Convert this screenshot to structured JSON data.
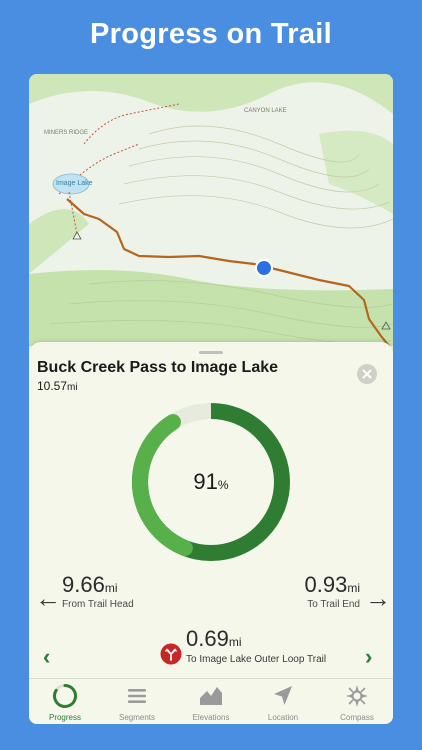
{
  "headline": "Progress on Trail",
  "map": {
    "labels": [
      "Image Lake",
      "CANYON LAKE",
      "MINERS RIDGE"
    ]
  },
  "trail": {
    "name": "Buck Creek Pass to Image Lake",
    "length_value": "10.57",
    "length_unit": "mi",
    "progress_fraction": 0.91,
    "progress_value": "91",
    "progress_unit": "%"
  },
  "from_head": {
    "value": "9.66",
    "unit": "mi",
    "caption": "From Trail Head"
  },
  "to_end": {
    "value": "0.93",
    "unit": "mi",
    "caption": "To Trail End"
  },
  "waypoint": {
    "value": "0.69",
    "unit": "mi",
    "caption": "To Image Lake Outer Loop Trail"
  },
  "tabs": [
    {
      "label": "Progress",
      "icon": "progress-ring-icon",
      "active": true
    },
    {
      "label": "Segments",
      "icon": "list-lines-icon",
      "active": false
    },
    {
      "label": "Elevations",
      "icon": "mountain-chart-icon",
      "active": false
    },
    {
      "label": "Location",
      "icon": "location-arrow-icon",
      "active": false
    },
    {
      "label": "Compass",
      "icon": "compass-icon",
      "active": false
    }
  ],
  "colors": {
    "background": "#4a8ee2",
    "ring_dark": "#2e7d32",
    "ring_light": "#57b04a",
    "trail_route": "#b5651d",
    "location_dot": "#2f6fe4",
    "accent_green": "#2e7d32"
  }
}
